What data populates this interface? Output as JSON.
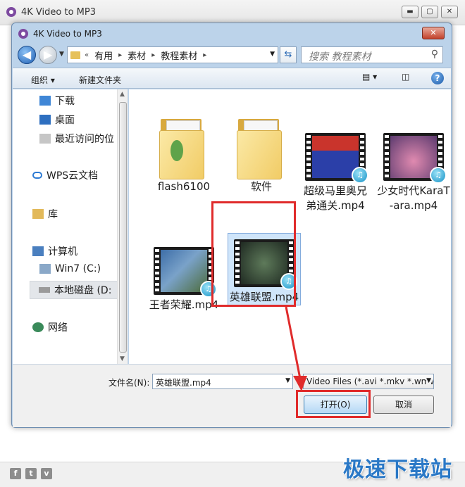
{
  "window": {
    "title": "4K Video to MP3",
    "minimize": "▬",
    "maximize": "▢",
    "close": "✕"
  },
  "dialog": {
    "title": "4K Video to MP3",
    "close": "✕"
  },
  "navigation": {
    "breadcrumb_prefix": "«",
    "breadcrumb": [
      "有用",
      "素材",
      "教程素材"
    ],
    "search_placeholder": "搜索 教程素材"
  },
  "toolbar": {
    "organize": "组织 ▾",
    "new_folder": "新建文件夹"
  },
  "nav_pane": {
    "items": [
      {
        "label": "下载"
      },
      {
        "label": "桌面"
      },
      {
        "label": "最近访问的位"
      },
      {
        "label": "WPS云文档"
      },
      {
        "label": "库"
      },
      {
        "label": "计算机"
      },
      {
        "label": "Win7 (C:)"
      },
      {
        "label": "本地磁盘 (D:"
      },
      {
        "label": "网络"
      }
    ]
  },
  "files": [
    {
      "name": "flash6100",
      "type": "folder"
    },
    {
      "name": "软件",
      "type": "folder"
    },
    {
      "name": "超级马里奥兄弟通关.mp4",
      "type": "video"
    },
    {
      "name": "少女时代KaraT-ara.mp4",
      "type": "video"
    },
    {
      "name": "王者荣耀.mp4",
      "type": "video"
    },
    {
      "name": "英雄联盟.mp4",
      "type": "video",
      "selected": true
    }
  ],
  "bottom": {
    "filename_label": "文件名(N):",
    "filename_value": "英雄联盟.mp4",
    "filetype_value": "Video Files (*.avi *.mkv *.wmv",
    "open_button": "打开(O)",
    "cancel_button": "取消"
  },
  "footer": {
    "social": [
      "f",
      "t",
      "v"
    ],
    "watermark": "极速下载站"
  },
  "colors": {
    "highlight": "#e02b2b",
    "selection": "#cfe5fa",
    "dialog_frame": "#bcd3ea"
  }
}
